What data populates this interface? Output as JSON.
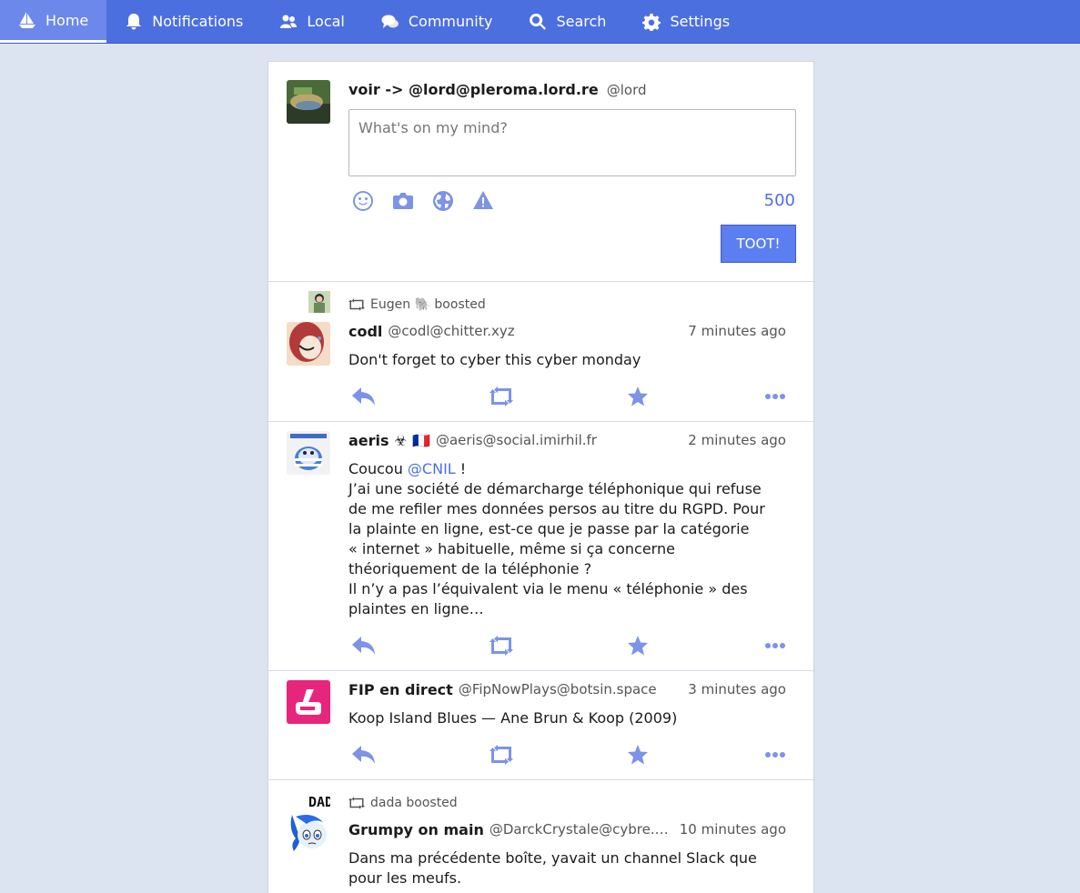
{
  "nav": {
    "home": "Home",
    "notifications": "Notifications",
    "local": "Local",
    "community": "Community",
    "search": "Search",
    "settings": "Settings"
  },
  "composer": {
    "name": "voir -> @lord@pleroma.lord.re",
    "acct": "@lord",
    "placeholder": "What's on my mind?",
    "counter": "500",
    "submit": "TOOT!"
  },
  "statuses": [
    {
      "boosted_by": "Eugen 🐘 boosted",
      "name": "codl",
      "acct": "@codl@chitter.xyz",
      "time": "7 minutes ago",
      "body": "Don't forget to cyber this cyber monday"
    },
    {
      "name": "aeris ☣ 🇫🇷",
      "acct": "@aeris@social.imirhil.fr",
      "time": "2 minutes ago",
      "body_prefix": "Coucou ",
      "mention": "@CNIL",
      "body_suffix": " !",
      "lines": [
        "J’ai une société de démarcharge téléphonique qui refuse",
        "de me refiler mes données persos au titre du RGPD. Pour",
        "la plainte en ligne, est-ce que je passe par la catégorie",
        "« internet » habituelle, même si ça concerne",
        "théoriquement de la téléphonie ?",
        "Il n’y a pas l’équivalent via le menu « téléphonie » des",
        "plaintes en ligne…"
      ]
    },
    {
      "name": "FIP en direct",
      "acct": "@FipNowPlays@botsin.space",
      "time": "3 minutes ago",
      "body": "Koop Island Blues — Ane Brun & Koop (2009)"
    },
    {
      "boosted_by": "dada boosted",
      "name": "Grumpy on main",
      "acct": "@DarckCrystale@cybre.space",
      "time": "10 minutes ago",
      "lines": [
        "Dans ma précédente boîte, yavait un channel Slack que",
        "pour les meufs."
      ]
    }
  ],
  "colors": {
    "navbar": "#4c6fe0",
    "accent": "#7c93e6",
    "background": "#dbe4f0"
  }
}
